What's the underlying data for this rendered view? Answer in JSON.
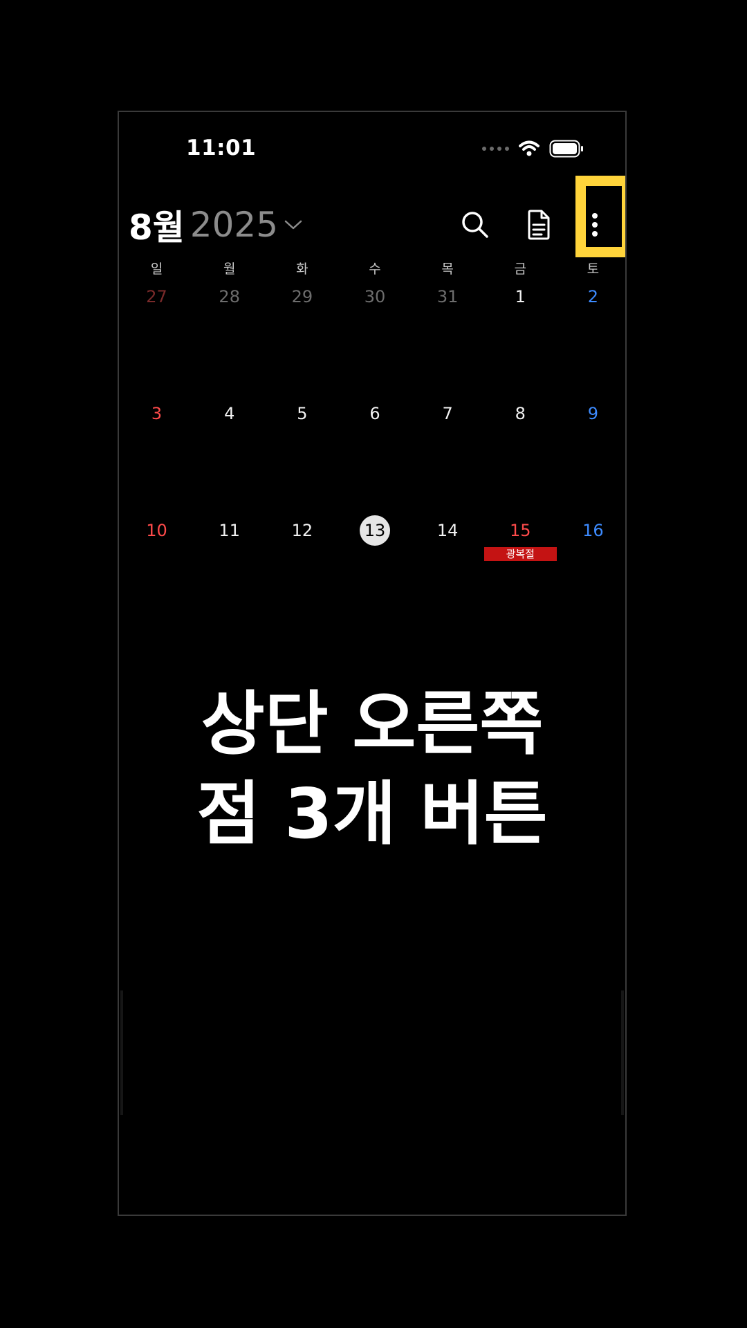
{
  "status_bar": {
    "time": "11:01"
  },
  "header": {
    "month": "8월",
    "year": "2025",
    "icons": [
      "search-icon",
      "document-icon",
      "more-vertical-icon"
    ]
  },
  "weekdays": [
    "일",
    "월",
    "화",
    "수",
    "목",
    "금",
    "토"
  ],
  "weeks": [
    [
      {
        "day": "27",
        "kind": "prev-sun"
      },
      {
        "day": "28",
        "kind": "prev"
      },
      {
        "day": "29",
        "kind": "prev"
      },
      {
        "day": "30",
        "kind": "prev"
      },
      {
        "day": "31",
        "kind": "prev"
      },
      {
        "day": "1",
        "kind": "norm"
      },
      {
        "day": "2",
        "kind": "sat"
      }
    ],
    [
      {
        "day": "3",
        "kind": "sun"
      },
      {
        "day": "4",
        "kind": "norm"
      },
      {
        "day": "5",
        "kind": "norm"
      },
      {
        "day": "6",
        "kind": "norm"
      },
      {
        "day": "7",
        "kind": "norm"
      },
      {
        "day": "8",
        "kind": "norm"
      },
      {
        "day": "9",
        "kind": "sat"
      }
    ],
    [
      {
        "day": "10",
        "kind": "sun"
      },
      {
        "day": "11",
        "kind": "norm"
      },
      {
        "day": "12",
        "kind": "norm"
      },
      {
        "day": "13",
        "kind": "today"
      },
      {
        "day": "14",
        "kind": "norm"
      },
      {
        "day": "15",
        "kind": "sun",
        "event": "광복절"
      },
      {
        "day": "16",
        "kind": "sat"
      }
    ]
  ],
  "overlay": {
    "line1": "상단 오른쪽",
    "line2": "점 3개 버튼"
  },
  "colors": {
    "highlight": "#ffd43b",
    "sunday": "#ff4b4b",
    "saturday": "#3d8bff",
    "holiday_tag": "#c41313"
  }
}
